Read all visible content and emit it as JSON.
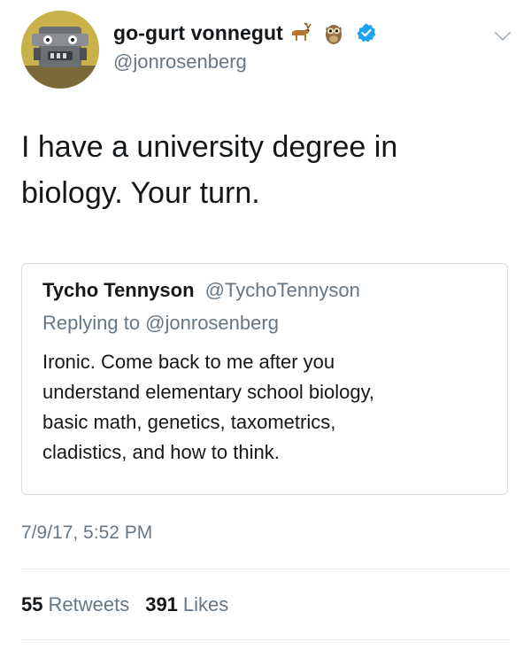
{
  "author": {
    "display_name": "go-gurt vonnegut",
    "handle": "@jonrosenberg",
    "name_emojis": [
      "deer-emoji",
      "owl-emoji"
    ],
    "verified_icon": "verified-badge-icon",
    "avatar_icon": "robot-avatar-icon"
  },
  "menu_icon": "chevron-down-icon",
  "tweet": {
    "text": "I have a university degree in\nbiology. Your turn."
  },
  "quoted_tweet": {
    "author_name": "Tycho Tennyson",
    "author_handle": "@TychoTennyson",
    "replying_to": "Replying to @jonrosenberg",
    "text": "Ironic. Come back to me after you\nunderstand elementary school biology,\nbasic math, genetics, taxometrics,\ncladistics, and how to think."
  },
  "timestamp": "7/9/17, 5:52 PM",
  "stats": {
    "retweets_count": "55",
    "retweets_label": "Retweets",
    "likes_count": "391",
    "likes_label": "Likes"
  },
  "colors": {
    "primary_text": "#14171a",
    "secondary_text": "#657786",
    "verified_blue": "#1da1f2",
    "border": "#d8dde1"
  }
}
